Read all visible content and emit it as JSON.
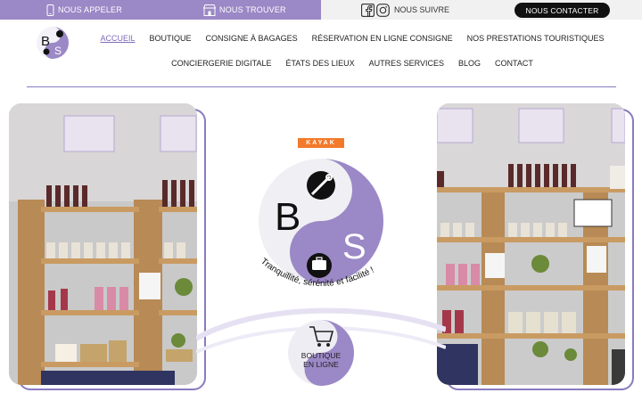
{
  "topbar": {
    "call": "NOUS APPELER",
    "find": "NOUS TROUVER",
    "follow": "NOUS SUIVRE",
    "contact": "NOUS CONTACTER"
  },
  "logo": {
    "letter_b": "B",
    "letter_s": "S"
  },
  "nav": {
    "row1": [
      "ACCUEIL",
      "BOUTIQUE",
      "CONSIGNE À BAGAGES",
      "RÉSERVATION EN LIGNE CONSIGNE",
      "NOS PRESTATIONS TOURISTIQUES"
    ],
    "row2": [
      "CONCIERGERIE DIGITALE",
      "ÉTATS DES LIEUX",
      "AUTRES SERVICES",
      "BLOG",
      "CONTACT"
    ],
    "active": "ACCUEIL"
  },
  "center": {
    "kayak": "KAYAK",
    "slogan": "Tranquillité, sérénité et facilité !",
    "shop_line1": "BOUTIQUE",
    "shop_line2": "EN LIGNE"
  },
  "colors": {
    "brand_purple": "#9b88c6",
    "accent_purple": "#7f6ab8",
    "kayak_orange": "#f27a2a"
  }
}
